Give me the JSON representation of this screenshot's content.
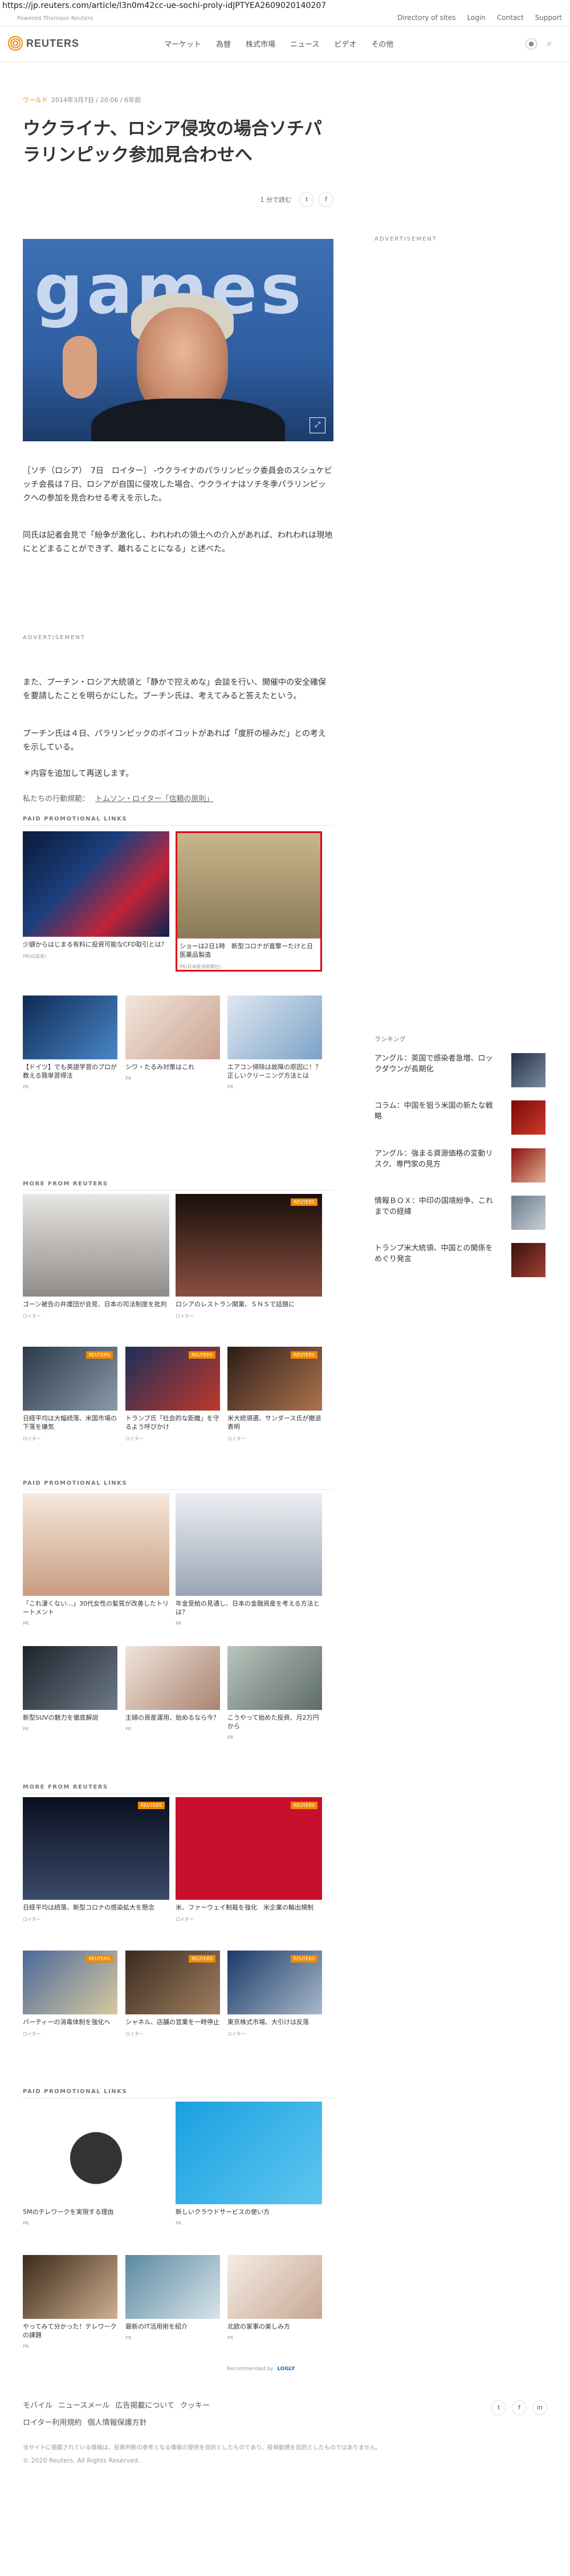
{
  "browser": {
    "url": "https://jp.reuters.com/article/l3n0m42cc-ue-sochi-proly-idJPTYEA2609020140207"
  },
  "header": {
    "byline": "Powered Thomson Reuters",
    "links": [
      "Directory of sites",
      "Login",
      "Contact",
      "Support"
    ]
  },
  "nav": {
    "logo": "REUTERS",
    "items": [
      "マーケット",
      "為替",
      "株式市場",
      "ニュース",
      "ビデオ",
      "その他"
    ]
  },
  "article": {
    "category": "ワールド",
    "date": "2014年3月7日 / 20:06 / 6年前",
    "title": "ウクライナ、ロシア侵攻の場合ソチパラリンピック参加見合わせへ",
    "read_time": "1 分で読む",
    "hero_text": "games",
    "p1": "［ソチ（ロシア）　7日　ロイター］ -ウクライナのパラリンピック委員会のスシュケビッチ会長は７日、ロシアが自国に侵攻した場合、ウクライナはソチ冬季パラリンピックへの参加を見合わせる考えを示した。",
    "p2": "同氏は記者会見で「紛争が激化し、われわれの領土への介入があれば、われわれは現地にとどまることができず、離れることになる」と述べた。",
    "ad_label": "ADVERTISEMENT",
    "p3": "また、プーチン・ロシア大統領と「静かで控えめな」会談を行い、開催中の安全確保を要請したことを明らかにした。プーチン氏は、考えてみると答えたという。",
    "p4": "プーチン氏は４日、パラリンピックのボイコットがあれば「度肝の極みだ」との考えを示している。",
    "p5": "＊内容を追加して再送します。",
    "principles_prefix": "私たちの行動規範：",
    "principles_link": "トムソン・ロイター「信頼の原則」"
  },
  "sections": {
    "promo": "PAID PROMOTIONAL LINKS",
    "more": "MORE FROM REUTERS",
    "recommended": "Recommended by",
    "outbrain": "LOGLY",
    "ranking": "ランキング",
    "side_ad": "ADVERTISEMENT"
  },
  "promo1": [
    {
      "cap": "少額からはじまる有料に投資可能なCFD取引とは？",
      "src": "PR(IG証券)"
    },
    {
      "cap": "ショーは2日1時　新型コロナが直撃ーたけと日医薬品製造",
      "src": "PR(日本経済新聞社)"
    },
    {
      "cap": "【ドイツ】でも英語学習のプロが教える簡単習得法",
      "src": "PR"
    },
    {
      "cap": "シワ・たるみ対策はこれ",
      "src": "PR"
    },
    {
      "cap": "エアコン掃除は故障の原因に！？正しいクリーニング方法とは",
      "src": "PR"
    }
  ],
  "more1": [
    {
      "cap": "ゴーン被告の弁護団が会見、日本の司法制度を批判",
      "src": "ロイター"
    },
    {
      "cap": "ロシアのレストラン開業、ＳＮＳで話題に",
      "src": "ロイター"
    },
    {
      "cap": "日経平均は大幅続落、米国市場の下落を嫌気",
      "src": "ロイター"
    },
    {
      "cap": "トランプ氏「社会的な距離」を守るよう呼びかけ",
      "src": "ロイター"
    },
    {
      "cap": "米大統領選、サンダース氏が撤退表明",
      "src": "ロイター"
    }
  ],
  "promo2": [
    {
      "cap": "「これ凄くない…」30代女性の髪質が改善したトリートメント",
      "src": "PR"
    },
    {
      "cap": "年金受給の見通し、日本の金融資産を考える方法とは？",
      "src": "PR"
    },
    {
      "cap": "新型SUVの魅力を徹底解説",
      "src": "PR"
    },
    {
      "cap": "主婦の資産運用、始めるなら今？",
      "src": "PR"
    },
    {
      "cap": "こうやって始めた投資、月2万円から",
      "src": "PR"
    }
  ],
  "more2": [
    {
      "cap": "日経平均は続落、新型コロナの感染拡大を懸念",
      "src": "ロイター"
    },
    {
      "cap": "米、ファーウェイ制裁を強化　米企業の輸出規制",
      "src": "ロイター"
    },
    {
      "cap": "パーティーの消毒体制を強化へ",
      "src": "ロイター"
    },
    {
      "cap": "シャネル、店舗の営業を一時停止",
      "src": "ロイター"
    },
    {
      "cap": "東京株式市場、大引けは反落",
      "src": "ロイター"
    }
  ],
  "promo3": [
    {
      "cap": "5Mのテレワークを実現する理由",
      "src": "PR"
    },
    {
      "cap": "新しいクラウドサービスの使い方",
      "src": "PR"
    },
    {
      "cap": "やってみて分かった！テレワークの課題",
      "src": "PR"
    },
    {
      "cap": "最新のIT活用術を紹介",
      "src": "PR"
    },
    {
      "cap": "北欧の家事の楽しみ方",
      "src": "PR"
    }
  ],
  "ranking": [
    {
      "t": "アングル：英国で感染者急増、ロックダウンが長期化"
    },
    {
      "t": "コラム：中国を狙う米国の新たな戦略"
    },
    {
      "t": "アングル：強まる資源価格の変動リスク、専門家の見方"
    },
    {
      "t": "情報ＢＯＸ：中印の国境紛争、これまでの経緯"
    },
    {
      "t": "トランプ米大統領、中国との関係をめぐり発言"
    }
  ],
  "footer": {
    "links": [
      "モバイル",
      "ニュースメール",
      "広告掲載について",
      "クッキー",
      "ロイター利用規約",
      "個人情報保護方針"
    ],
    "note": "当サイトに掲載されている情報は、投資判断の参考となる情報の提供を目的としたものであり、投資勧誘を目的としたものではありません。",
    "copyright": "© 2020 Reuters. All Rights Reserved."
  }
}
